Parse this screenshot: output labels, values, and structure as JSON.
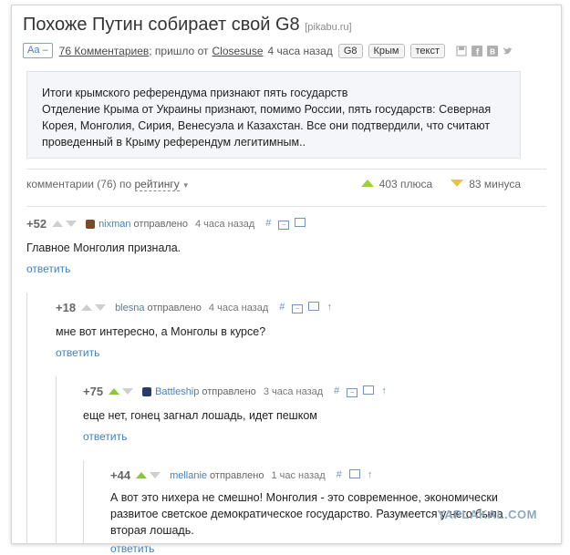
{
  "post": {
    "title": "Похоже Путин собирает свой G8",
    "source": "[pikabu.ru]",
    "font_toggle": "Aa –",
    "comments_link": "76 Комментариев",
    "came_from_prefix": "; пришло от",
    "author": "Closesuse",
    "time": "4 часа назад",
    "tags": [
      "G8",
      "Крым",
      "текст"
    ],
    "share_icons": [
      "save-icon",
      "facebook-icon",
      "vk-icon",
      "twitter-icon"
    ],
    "body_line1": "Итоги крымского референдума признают пять государств",
    "body_line2": "Отделение Крыма от Украины признают, помимо России, пять государств: Северная Корея, Монголия, Сирия, Венесуэла и Казахстан. Все они подтвердили, что считают проведенный в Крыму референдум легитимным.."
  },
  "sort": {
    "prefix": "комментарии (76) по",
    "by": "рейтингу",
    "plus": "403 плюса",
    "minus": "83 минуса"
  },
  "comments": [
    {
      "score": "+52",
      "user": "nixman",
      "sent": "отправлено",
      "time": "4 часа назад",
      "text": "Главное Монголия признала.",
      "reply": "ответить",
      "upvoted": false,
      "avatar_color": "#7a4a2a"
    },
    {
      "score": "+18",
      "user": "blesna",
      "sent": "отправлено",
      "time": "4 часа назад",
      "text": "мне вот интересно, а Монголы в курсе?",
      "reply": "ответить",
      "upvoted": false,
      "avatar_color": ""
    },
    {
      "score": "+75",
      "user": "Battleship",
      "sent": "отправлено",
      "time": "3 часа назад",
      "text": "еще нет, гонец загнал лошадь, идет пешком",
      "reply": "ответить",
      "upvoted": true,
      "avatar_color": "#2a3a6a"
    },
    {
      "score": "+44",
      "user": "mellanie",
      "sent": "отправлено",
      "time": "1 час назад",
      "text": "А вот это нихера не смешно! Монголия - это современное, экономически развитое светское демократическое государство. Разумеется у него была вторая лошадь.",
      "reply": "ответить",
      "upvoted": true,
      "avatar_color": ""
    }
  ],
  "watermark": "YAPLAKAL.COM",
  "colors": {
    "link": "#4a7fb0",
    "upvote": "#8cc63f",
    "downvote": "#e8c23a"
  }
}
